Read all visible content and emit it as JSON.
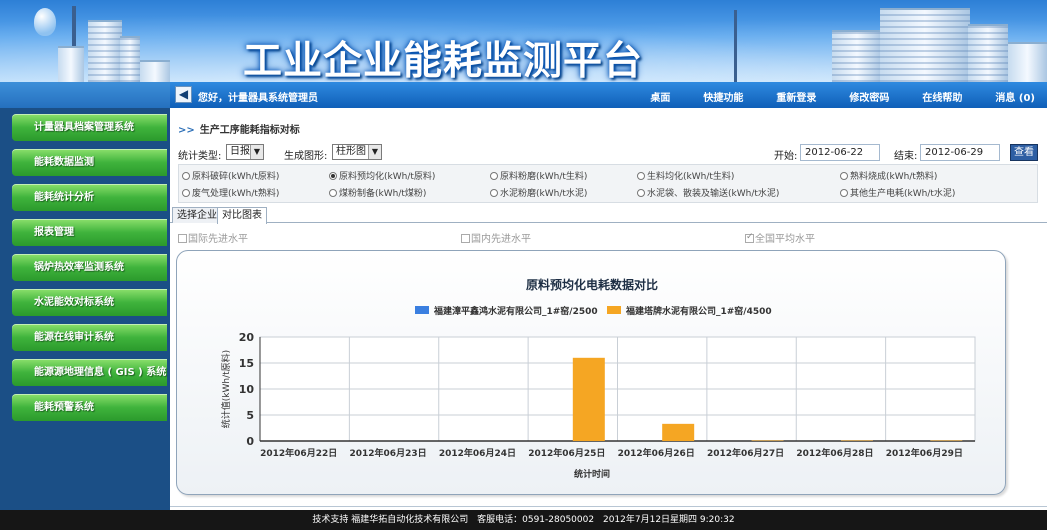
{
  "header": {
    "title": "工业企业能耗监测平台"
  },
  "nav": {
    "greeting": "您好，计量器具系统管理员",
    "links": [
      "桌面",
      "快捷功能",
      "重新登录",
      "修改密码",
      "在线帮助",
      "消息 (0)"
    ]
  },
  "sidebar": {
    "items": [
      "计量器具档案管理系统",
      "能耗数据监测",
      "能耗统计分析",
      "报表管理",
      "锅炉热效率监测系统",
      "水泥能效对标系统",
      "能源在线审计系统",
      "能源源地理信息 ( GIS ) 系统",
      "能耗预警系统"
    ]
  },
  "section": {
    "title": "生产工序能耗指标对标"
  },
  "filters": {
    "stat_type_label": "统计类型:",
    "stat_type_value": "日报",
    "chart_type_label": "生成图形:",
    "chart_type_value": "柱形图",
    "start_label": "开始:",
    "start_value": "2012-06-22",
    "end_label": "结束:",
    "end_value": "2012-06-29",
    "query_label": "查看"
  },
  "radios": [
    {
      "label": "原料破碎(kWh/t原料)",
      "checked": false
    },
    {
      "label": "原料预均化(kWh/t原料)",
      "checked": true
    },
    {
      "label": "原料粉磨(kWh/t生料)",
      "checked": false
    },
    {
      "label": "生料均化(kWh/t生料)",
      "checked": false
    },
    {
      "label": "熟料烧成(kWh/t熟料)",
      "checked": false
    },
    {
      "label": "废气处理(kWh/t熟料)",
      "checked": false
    },
    {
      "label": "煤粉制备(kWh/t煤粉)",
      "checked": false
    },
    {
      "label": "水泥粉磨(kWh/t水泥)",
      "checked": false
    },
    {
      "label": "水泥袋、散装及输送(kWh/t水泥)",
      "checked": false
    },
    {
      "label": "其他生产电耗(kWh/t水泥)",
      "checked": false
    }
  ],
  "tabs": [
    {
      "label": "选择企业",
      "active": false
    },
    {
      "label": "对比图表",
      "active": true
    }
  ],
  "benchmarks": [
    {
      "label": "国际先进水平",
      "checked": false
    },
    {
      "label": "国内先进水平",
      "checked": false
    },
    {
      "label": "全国平均水平",
      "checked": true
    }
  ],
  "chart_data": {
    "type": "bar",
    "title": "原料预均化电耗数据对比",
    "xlabel": "统计时间",
    "ylabel": "统计值(kWh/t原料)",
    "ylim": [
      0,
      20
    ],
    "yticks": [
      0,
      5,
      10,
      15,
      20
    ],
    "grid": true,
    "legend_position": "top",
    "categories": [
      "2012年06月22日",
      "2012年06月23日",
      "2012年06月24日",
      "2012年06月25日",
      "2012年06月26日",
      "2012年06月27日",
      "2012年06月28日",
      "2012年06月29日"
    ],
    "series": [
      {
        "name": "福建漳平鑫鸿水泥有限公司_1#窑/2500",
        "color": "#3a7fe0",
        "values": [
          0,
          0,
          0,
          0,
          0,
          0,
          0,
          0
        ]
      },
      {
        "name": "福建塔牌水泥有限公司_1#窑/4500",
        "color": "#f5a623",
        "values": [
          0,
          0,
          0,
          16,
          3.3,
          0.1,
          0.1,
          0.1
        ]
      }
    ]
  },
  "footer": {
    "support": "技术支持  福建华拓自动化技术有限公司",
    "hotline": "客服电话：0591-28050002",
    "datetime": "2012年7月12日星期四 9:20:32"
  }
}
